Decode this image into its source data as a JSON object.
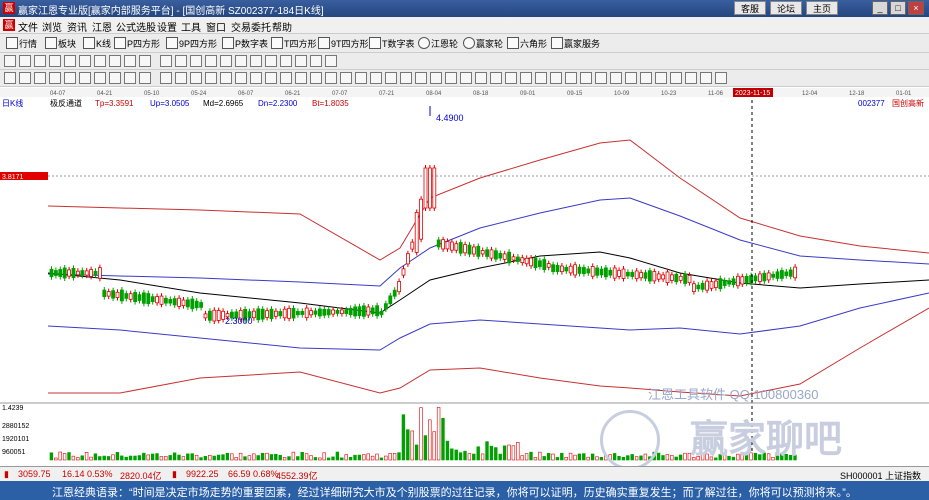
{
  "app": {
    "logo": "赢",
    "title": "赢家江恩专业版[赢家内部服务平台] - [国创高新   SZ002377-184日K线]",
    "top_buttons": [
      "客服",
      "论坛",
      "主页"
    ]
  },
  "menu": [
    "文件",
    "浏览",
    "资讯",
    "江恩",
    "公式选股",
    "设置",
    "工具",
    "窗口",
    "交易委托",
    "帮助"
  ],
  "toolbar1": [
    "行情",
    "板块",
    "K线",
    "P四方形",
    "9P四方形",
    "P数字表",
    "T四方形",
    "9T四方形",
    "T数字表",
    "江恩轮",
    "赢家轮",
    "六角形",
    "赢家服务"
  ],
  "chart_data": {
    "type": "candlestick",
    "period_label": "日K线",
    "indicator": {
      "name": "极反通道",
      "Tp": "Tp=3.3591",
      "Up": "Up=3.0505",
      "Md": "Md=2.6965",
      "Dn": "Dn=2.2300",
      "Bt": "Bt=1.8035"
    },
    "code": "002377",
    "name": "国创高新",
    "dates": [
      "04-07",
      "04-21",
      "05-10",
      "05-24",
      "06-07",
      "06-21",
      "07-07",
      "07-21",
      "08-04",
      "08-18",
      "09-01",
      "09-15",
      "10-09",
      "10-23",
      "11-06",
      "2023-11-15",
      "12-04",
      "12-18",
      "01-01"
    ],
    "cursor_date": "2023-11-15",
    "price_axis_label": "3.8171",
    "high_label": "4.4900",
    "low_label": "2.3000",
    "volume_axis_labels": [
      "1.4239",
      "2880152",
      "1920101",
      "960051"
    ],
    "colors": {
      "up": "#e00000",
      "down": "#00a000",
      "upper_band": "#c83030",
      "mid_band": "#3a3ac8",
      "avg": "#000000"
    }
  },
  "status": {
    "sh": "3059.75",
    "sh_change": "16.14 0.53%",
    "sh_amount": "2820.04亿",
    "sz": "9922.25",
    "sz_change": "66.59 0.68%",
    "sz_amount": "4552.39亿",
    "index_label": "SH000001 上证指数"
  },
  "watermark": {
    "tool": "江恩工具软件  QQ:100800360",
    "brand": "赢家聊吧"
  },
  "quote": "江恩经典语录：“时间是决定市场走势的重要因素，经过详细研究大市及个别股票的过往记录，你将可以证明，历史确实重复发生；而了解过往，你将可以预测将来。”。"
}
